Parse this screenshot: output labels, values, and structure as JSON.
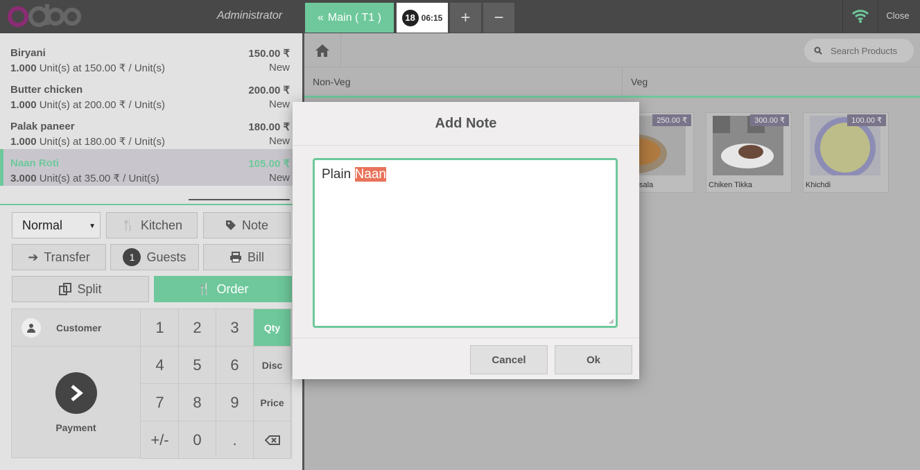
{
  "brand": {
    "accent": "#6ec89b",
    "topbar": "#484848",
    "logo_color": "#8b2c74"
  },
  "header": {
    "user": "Administrator",
    "main_button": "Main ( T1 )",
    "table_badge": "18",
    "time": "06:15",
    "add_label": "+",
    "remove_label": "−",
    "close_label": "Close"
  },
  "order": {
    "lines": [
      {
        "name": "Biryani",
        "total": "150.00 ₹",
        "qty": "1.000",
        "detail": "Unit(s) at 150.00 ₹ / Unit(s)",
        "status": "New"
      },
      {
        "name": "Butter chicken",
        "total": "200.00 ₹",
        "qty": "1.000",
        "detail": "Unit(s) at 200.00 ₹ / Unit(s)",
        "status": "New"
      },
      {
        "name": "Palak paneer",
        "total": "180.00 ₹",
        "qty": "1.000",
        "detail": "Unit(s) at 180.00 ₹ / Unit(s)",
        "status": "New"
      },
      {
        "name": "Naan Roti",
        "total": "105.00 ₹",
        "qty": "3.000",
        "detail": "Unit(s) at 35.00 ₹ / Unit(s)",
        "status": "New"
      }
    ]
  },
  "controls": {
    "priority": "Normal",
    "kitchen": "Kitchen",
    "note": "Note",
    "transfer": "Transfer",
    "guests_count": "1",
    "guests": "Guests",
    "bill": "Bill",
    "split": "Split",
    "order": "Order"
  },
  "numpad": {
    "customer": "Customer",
    "payment": "Payment",
    "keys": [
      "1",
      "2",
      "3",
      "4",
      "5",
      "6",
      "7",
      "8",
      "9",
      "+/-",
      "0",
      "."
    ],
    "modes": [
      "Qty",
      "Disc",
      "Price"
    ]
  },
  "products": {
    "search_placeholder": "Search Products",
    "categories": [
      "Non-Veg",
      "Veg"
    ],
    "items": [
      {
        "name": "tikka masala",
        "price": "250.00 ₹"
      },
      {
        "name": "Chiken Tikka",
        "price": "300.00 ₹"
      },
      {
        "name": "Khichdi",
        "price": "100.00 ₹"
      }
    ]
  },
  "modal": {
    "title": "Add Note",
    "text_plain": "Plain ",
    "text_selected": "Naan",
    "cancel": "Cancel",
    "ok": "Ok"
  }
}
